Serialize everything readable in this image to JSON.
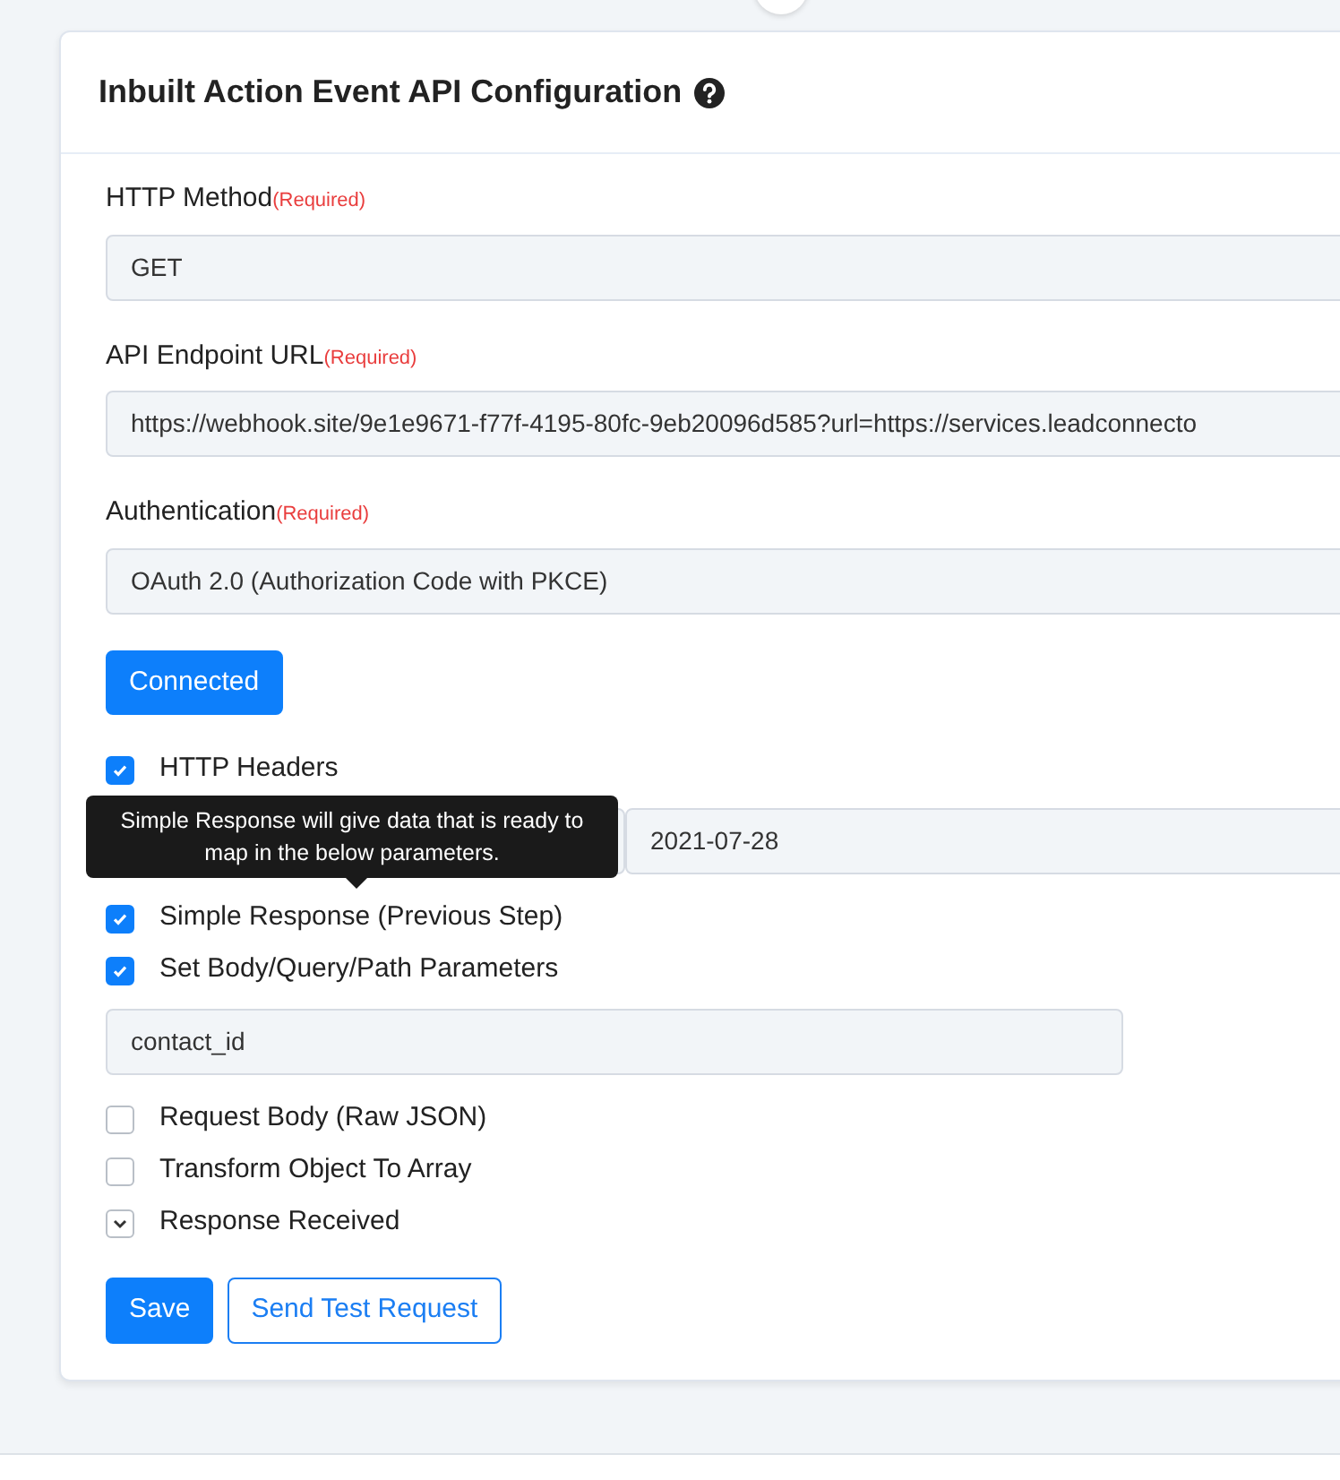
{
  "title": "Inbuilt Action Event API Configuration",
  "fields": [
    {
      "label": "HTTP Method",
      "required": "(Required)",
      "value": "GET"
    },
    {
      "label": "API Endpoint URL",
      "required": "(Required)",
      "value": "https://webhook.site/9e1e9671-f77f-4195-80fc-9eb20096d585?url=https://services.leadconnecto"
    },
    {
      "label": "Authentication",
      "required": "(Required)",
      "value": "OAuth 2.0 (Authorization Code with PKCE)"
    }
  ],
  "connect_button": "Connected",
  "options": [
    {
      "kind": "checkbox",
      "label": "HTTP Headers",
      "checked": true,
      "rows": [
        {
          "kind": "pair",
          "value": "2021-07-28"
        }
      ]
    },
    {
      "kind": "checkbox",
      "label": "Simple Response (Previous Step)",
      "checked": true
    },
    {
      "kind": "checkbox",
      "label": "Set Body/Query/Path Parameters",
      "checked": true,
      "rows": [
        {
          "kind": "single",
          "value": "contact_id"
        }
      ]
    },
    {
      "kind": "checkbox",
      "label": "Request Body (Raw JSON)",
      "checked": false
    },
    {
      "kind": "checkbox",
      "label": "Transform Object To Array",
      "checked": false
    },
    {
      "kind": "collapse",
      "label": "Response Received",
      "expanded": false
    }
  ],
  "tooltip": {
    "text": "Simple Response will give data that is ready to map in the below parameters."
  },
  "buttons": [
    {
      "kind": "primary",
      "label": "Save"
    },
    {
      "kind": "outline",
      "label": "Send Test Request"
    }
  ]
}
